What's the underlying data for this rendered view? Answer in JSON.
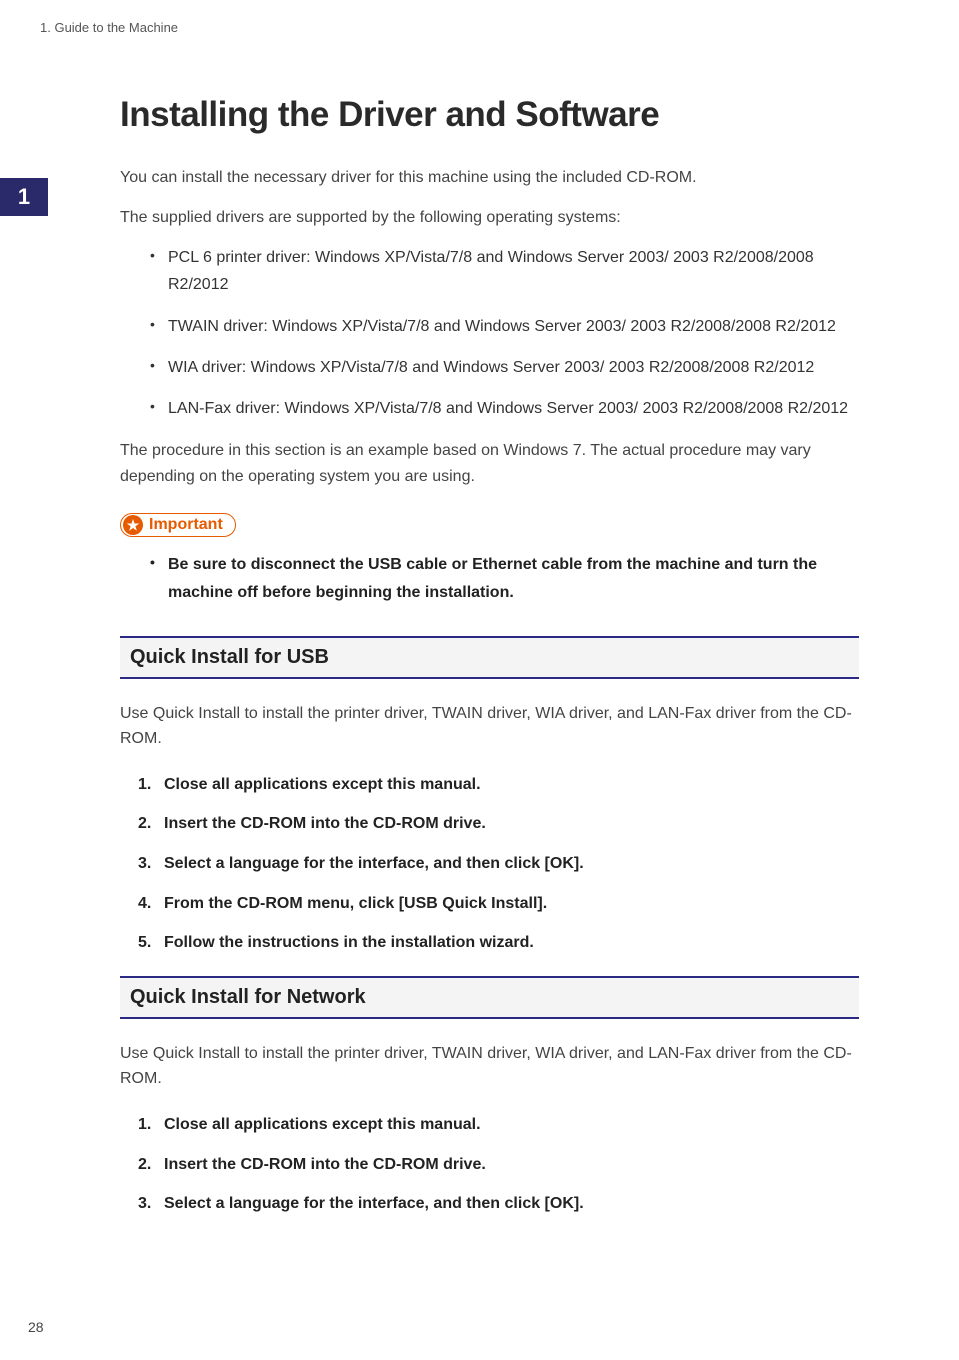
{
  "header": "1. Guide to the Machine",
  "side_tab": "1",
  "title": "Installing the Driver and Software",
  "intro1": "You can install the necessary driver for this machine using the included CD-ROM.",
  "intro2": "The supplied drivers are supported by the following operating systems:",
  "drivers": [
    "PCL 6 printer driver: Windows XP/Vista/7/8 and Windows Server 2003/ 2003 R2/2008/2008 R2/2012",
    "TWAIN driver: Windows XP/Vista/7/8 and Windows Server 2003/ 2003 R2/2008/2008 R2/2012",
    "WIA driver: Windows XP/Vista/7/8 and Windows Server 2003/ 2003 R2/2008/2008 R2/2012",
    "LAN-Fax driver: Windows XP/Vista/7/8 and Windows Server 2003/ 2003 R2/2008/2008 R2/2012"
  ],
  "intro3": "The procedure in this section is an example based on Windows 7. The actual procedure may vary depending on the operating system you are using.",
  "important_label": "Important",
  "important_items": [
    "Be sure to disconnect the USB cable or Ethernet cable from the machine and turn the machine off before beginning the installation."
  ],
  "section1": {
    "heading": "Quick Install for USB",
    "para": "Use Quick Install to install the printer driver, TWAIN driver, WIA driver, and LAN-Fax driver from the CD-ROM.",
    "steps": [
      "Close all applications except this manual.",
      "Insert the CD-ROM into the CD-ROM drive.",
      "Select a language for the interface, and then click [OK].",
      "From the CD-ROM menu, click [USB Quick Install].",
      "Follow the instructions in the installation wizard."
    ]
  },
  "section2": {
    "heading": "Quick Install for Network",
    "para": "Use Quick Install to install the printer driver, TWAIN driver, WIA driver, and LAN-Fax driver from the CD-ROM.",
    "steps": [
      "Close all applications except this manual.",
      "Insert the CD-ROM into the CD-ROM drive.",
      "Select a language for the interface, and then click [OK]."
    ]
  },
  "page_number": "28"
}
